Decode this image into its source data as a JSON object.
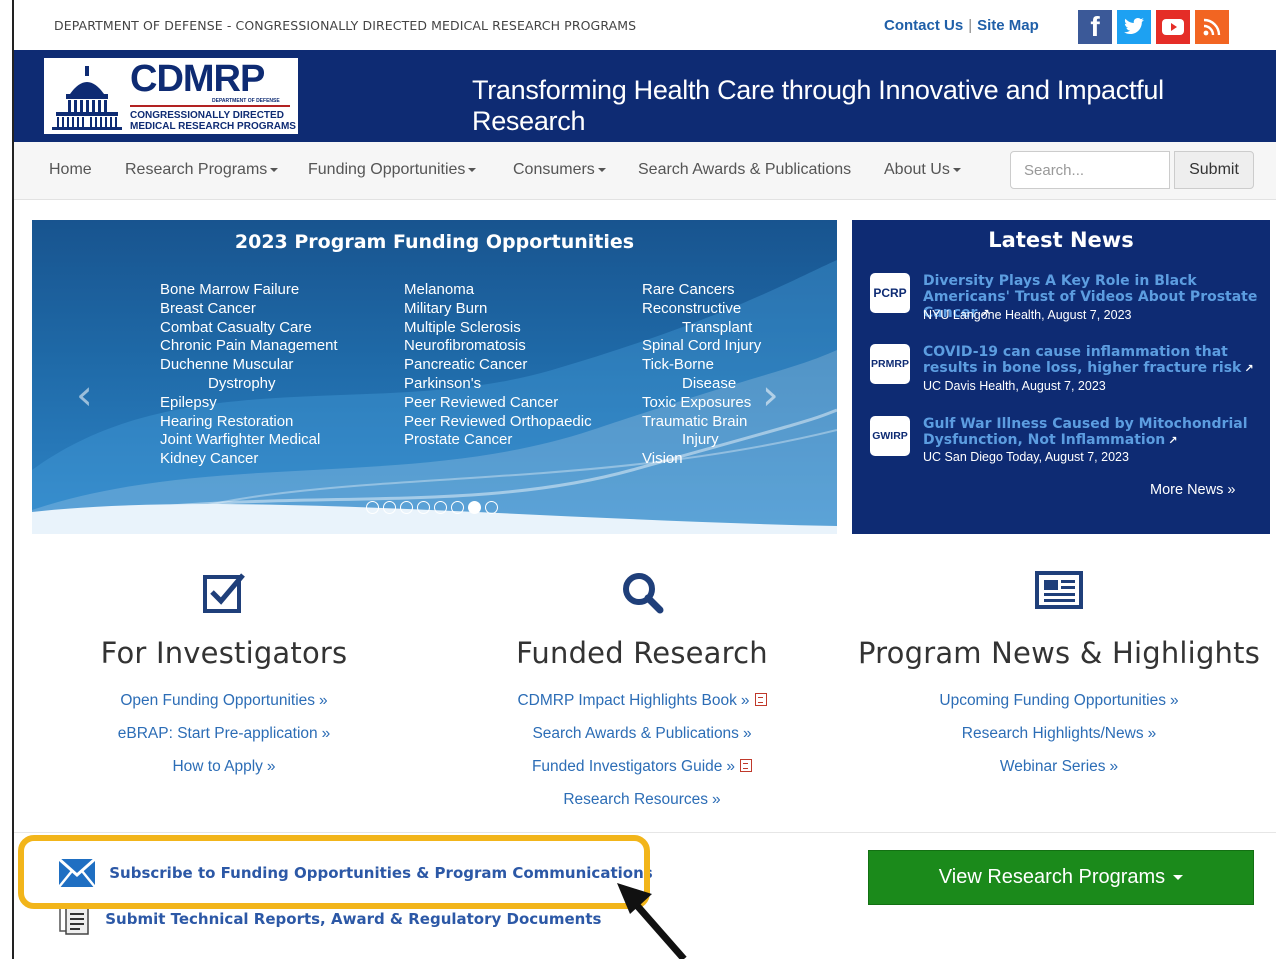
{
  "topbar": {
    "department": "DEPARTMENT OF DEFENSE - CONGRESSIONALLY DIRECTED MEDICAL RESEARCH PROGRAMS",
    "contact_label": "Contact Us",
    "sitemap_label": "Site Map",
    "separator": "|",
    "social": [
      {
        "name": "facebook-icon",
        "glyph": "f",
        "color": "#3b5998"
      },
      {
        "name": "twitter-icon",
        "glyph": "t",
        "color": "#1da1f2"
      },
      {
        "name": "youtube-icon",
        "glyph": "▶",
        "color": "#e52d27"
      },
      {
        "name": "rss-icon",
        "glyph": "rss",
        "color": "#f26522"
      }
    ]
  },
  "banner": {
    "logo_main": "CDMRP",
    "logo_dod": "DEPARTMENT OF DEFENSE",
    "logo_sub_1": "CONGRESSIONALLY DIRECTED",
    "logo_sub_2": "MEDICAL RESEARCH PROGRAMS",
    "tagline": "Transforming Health Care through Innovative and Impactful Research",
    "color": "#0e2b73"
  },
  "nav": {
    "home": "Home",
    "research_programs": "Research Programs",
    "funding_opportunities": "Funding Opportunities",
    "consumers": "Consumers",
    "search_awards": "Search Awards & Publications",
    "about_us": "About Us",
    "search_placeholder": "Search...",
    "submit": "Submit"
  },
  "carousel": {
    "title": "2023 Program Funding Opportunities",
    "col1": [
      "Bone Marrow Failure",
      "Breast Cancer",
      "Combat Casualty Care",
      "Chronic Pain Management",
      "Duchenne Muscular",
      "Dystrophy",
      "Epilepsy",
      "Hearing Restoration",
      "Joint Warfighter Medical",
      "Kidney Cancer"
    ],
    "col2": [
      "Melanoma",
      "Military Burn",
      "Multiple Sclerosis",
      "Neurofibromatosis",
      "Pancreatic Cancer",
      "Parkinson's",
      "Peer Reviewed Cancer",
      "Peer Reviewed Orthopaedic",
      "Prostate Cancer"
    ],
    "col3": [
      "Rare Cancers",
      "Reconstructive",
      "Transplant",
      "Spinal Cord Injury",
      "Tick-Borne",
      "Disease",
      "Toxic Exposures",
      "Traumatic Brain",
      "Injury",
      "Vision"
    ],
    "prev": "‹",
    "next": "›",
    "slide_count": 8,
    "active_slide": 7
  },
  "news": {
    "title": "Latest News",
    "items": [
      {
        "badge": "PCRP",
        "headline": "Diversity Plays A Key Role in Black Americans' Trust of Videos About Prostate Cancer",
        "source": "NYU Langone Health, August 7, 2023"
      },
      {
        "badge": "PRMRP",
        "headline": "COVID-19 can cause inflammation that results in bone loss, higher fracture risk",
        "source": "UC Davis Health, August 7, 2023"
      },
      {
        "badge": "GWIRP",
        "headline": "Gulf War Illness Caused by Mitochondrial Dysfunction, Not Inflammation",
        "source": "UC San Diego Today, August 7, 2023"
      }
    ],
    "more": "More News »"
  },
  "columns": {
    "investigators": {
      "title": "For Investigators",
      "links": [
        "Open Funding Opportunities",
        "eBRAP: Start Pre-application",
        "How to Apply"
      ]
    },
    "funded": {
      "title": "Funded Research",
      "links": [
        "CDMRP Impact Highlights Book",
        "Search Awards & Publications",
        "Funded Investigators Guide",
        "Research Resources"
      ]
    },
    "news": {
      "title": "Program News & Highlights",
      "links": [
        "Upcoming Funding Opportunities",
        "Research Highlights/News",
        "Webinar Series"
      ]
    },
    "raquo": "»"
  },
  "bottom": {
    "subscribe": "Subscribe to Funding Opportunities & Program Communications",
    "submit_reports": "Submit Technical Reports, Award & Regulatory Documents",
    "view_programs": "View Research Programs",
    "highlight_color": "#f2b51a",
    "button_color": "#1b8a1b"
  }
}
